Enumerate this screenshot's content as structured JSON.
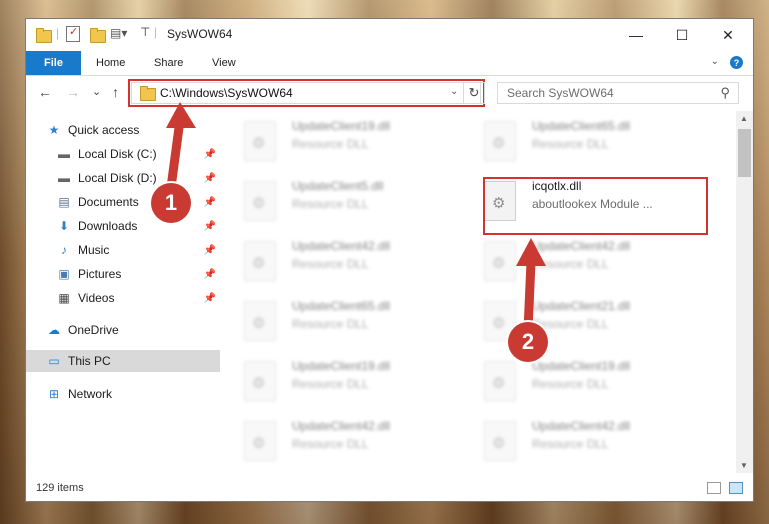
{
  "window": {
    "title": "SysWOW64",
    "minimize_glyph": "—",
    "maximize_glyph": "☐",
    "close_glyph": "✕"
  },
  "ribbon": {
    "file": "File",
    "tabs": [
      "Home",
      "Share",
      "View"
    ],
    "expand_glyph": "⌄",
    "help_glyph": "?"
  },
  "nav": {
    "back_glyph": "←",
    "forward_glyph": "→",
    "recent_glyph": "⌄",
    "up_glyph": "↑",
    "address": "C:\\Windows\\SysWOW64",
    "address_dropdown_glyph": "⌄",
    "refresh_glyph": "↻",
    "search_placeholder": "Search SysWOW64",
    "search_glyph": "⚲"
  },
  "sidebar": {
    "items": [
      {
        "label": "Quick access",
        "icon": "star-icon",
        "glyph": "★",
        "pinned": false
      },
      {
        "label": "Local Disk (C:)",
        "icon": "drive-icon",
        "glyph": "▬",
        "pinned": true
      },
      {
        "label": "Local Disk (D:)",
        "icon": "drive-icon",
        "glyph": "▬",
        "pinned": true
      },
      {
        "label": "Documents",
        "icon": "documents-icon",
        "glyph": "▤",
        "pinned": true
      },
      {
        "label": "Downloads",
        "icon": "downloads-icon",
        "glyph": "⬇",
        "pinned": true
      },
      {
        "label": "Music",
        "icon": "music-icon",
        "glyph": "♪",
        "pinned": true
      },
      {
        "label": "Pictures",
        "icon": "pictures-icon",
        "glyph": "▣",
        "pinned": true
      },
      {
        "label": "Videos",
        "icon": "videos-icon",
        "glyph": "▦",
        "pinned": true
      },
      {
        "label": "OneDrive",
        "icon": "cloud-icon",
        "glyph": "☁",
        "pinned": false
      },
      {
        "label": "This PC",
        "icon": "computer-icon",
        "glyph": "▭",
        "pinned": false,
        "selected": true
      },
      {
        "label": "Network",
        "icon": "network-icon",
        "glyph": "⊞",
        "pinned": false
      }
    ],
    "pin_glyph": "📌"
  },
  "files": {
    "left_column": [
      {
        "name": "UpdateClient19.dll",
        "type": "Resource DLL"
      },
      {
        "name": "UpdateClient5.dll",
        "type": "Resource DLL"
      },
      {
        "name": "UpdateClient42.dll",
        "type": "Resource DLL"
      },
      {
        "name": "UpdateClient65.dll",
        "type": "Resource DLL"
      },
      {
        "name": "UpdateClient19.dll",
        "type": "Resource DLL"
      },
      {
        "name": "UpdateClient42.dll",
        "type": "Resource DLL"
      }
    ],
    "right_column": [
      {
        "name": "UpdateClient65.dll",
        "type": "Resource DLL"
      },
      {
        "name": "icqotlx.dll",
        "type": "aboutlookex Module ...",
        "highlighted": true
      },
      {
        "name": "UpdateClient42.dll",
        "type": "Resource DLL"
      },
      {
        "name": "UpdateClient21.dll",
        "type": "Resource DLL"
      },
      {
        "name": "UpdateClient19.dll",
        "type": "Resource DLL"
      },
      {
        "name": "UpdateClient42.dll",
        "type": "Resource DLL"
      }
    ]
  },
  "status": {
    "item_count": "129 items"
  },
  "callouts": {
    "one": "1",
    "two": "2"
  },
  "colors": {
    "accent": "#1979ca",
    "highlight": "#d0342c",
    "callout": "#c93a32"
  }
}
